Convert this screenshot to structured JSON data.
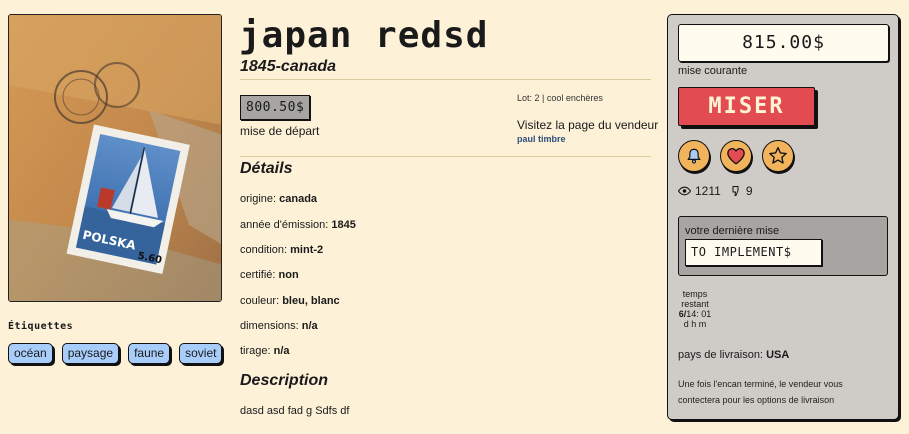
{
  "item": {
    "title": "japan redsd",
    "subtitle": "1845-canada",
    "start_price": "800.50$",
    "start_label": "mise de départ",
    "lot": "Lot: 2 | cool enchères",
    "visit_label": "Visitez la page du vendeur",
    "seller": "paul timbre",
    "image_text": "POLSKA",
    "image_value": "5.60"
  },
  "tags": {
    "title": "Étiquettes",
    "items": [
      "océan",
      "paysage",
      "faune",
      "soviet"
    ]
  },
  "details": {
    "heading": "Détails",
    "rows": [
      {
        "label": "origine:",
        "value": "canada"
      },
      {
        "label": "année d'émission:",
        "value": "1845"
      },
      {
        "label": "condition:",
        "value": "mint-2"
      },
      {
        "label": "certifié:",
        "value": "non"
      },
      {
        "label": "couleur:",
        "value": "bleu, blanc"
      },
      {
        "label": "dimensions:",
        "value": "n/a"
      },
      {
        "label": "tirage:",
        "value": "n/a"
      }
    ]
  },
  "description": {
    "heading": "Description",
    "text": "dasd asd fad g Sdfs df"
  },
  "panel": {
    "current_price": "815.00$",
    "current_label": "mise courante",
    "bid_button": "MISER",
    "icons": [
      "bell-icon",
      "heart-icon",
      "star-icon"
    ],
    "views": "1211",
    "bids": "9",
    "last_bid_label": "votre dernière mise",
    "last_bid_value": "TO IMPLEMENT$",
    "timer_label_1": "temps",
    "timer_label_2": "restant",
    "timer_days": "6/",
    "timer_time": "14: 01",
    "timer_units": "d  h  m",
    "shipping_label": "pays de livraison:",
    "shipping_country": "USA",
    "note": "Une fois l'encan terminé, le vendeur vous contectera pour les options de livraison"
  },
  "colors": {
    "background": "#fdf1d8",
    "bid_button": "#e24b4f",
    "tag": "#a8cdfb",
    "panel": "#cfccc8",
    "icon_circle": "#f1b35c"
  }
}
